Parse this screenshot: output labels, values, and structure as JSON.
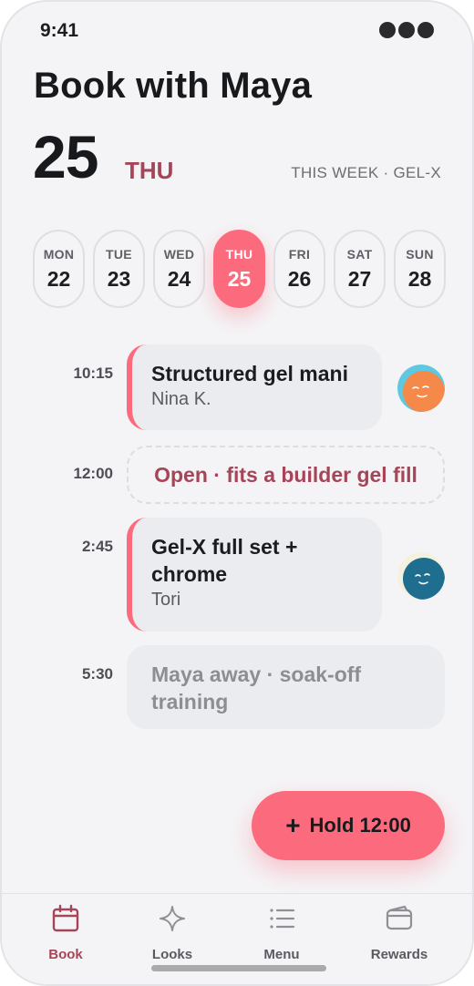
{
  "status": {
    "time": "9:41"
  },
  "header": {
    "title": "Book with Maya",
    "date_number": "25",
    "date_day": "THU",
    "week_meta": "THIS WEEK · GEL-X"
  },
  "days": [
    {
      "dow": "MON",
      "num": "22",
      "active": false
    },
    {
      "dow": "TUE",
      "num": "23",
      "active": false
    },
    {
      "dow": "WED",
      "num": "24",
      "active": false
    },
    {
      "dow": "THU",
      "num": "25",
      "active": true
    },
    {
      "dow": "FRI",
      "num": "26",
      "active": false
    },
    {
      "dow": "SAT",
      "num": "27",
      "active": false
    },
    {
      "dow": "SUN",
      "num": "28",
      "active": false
    }
  ],
  "schedule": {
    "slot1": {
      "time": "10:15",
      "title": "Structured gel mani",
      "client": "Nina K."
    },
    "slot2": {
      "time": "12:00",
      "label": "Open · fits a builder gel fill"
    },
    "slot3": {
      "time": "2:45",
      "title_line1": "Gel-X full set +",
      "title_line2": "chrome",
      "client": "Tori"
    },
    "slot4": {
      "time": "5:30",
      "line1": "Maya away · soak-off",
      "line2": "training"
    }
  },
  "fab": {
    "plus": "+",
    "label": "Hold 12:00"
  },
  "tabs": [
    {
      "label": "Book",
      "icon": "calendar-icon",
      "active": true
    },
    {
      "label": "Looks",
      "icon": "sparkle-icon",
      "active": false
    },
    {
      "label": "Menu",
      "icon": "list-icon",
      "active": false
    },
    {
      "label": "Rewards",
      "icon": "wallet-icon",
      "active": false
    }
  ],
  "colors": {
    "accent": "#fb6b7d",
    "accent_dark": "#a64557",
    "background": "#f4f4f6",
    "card": "#ebecef"
  }
}
